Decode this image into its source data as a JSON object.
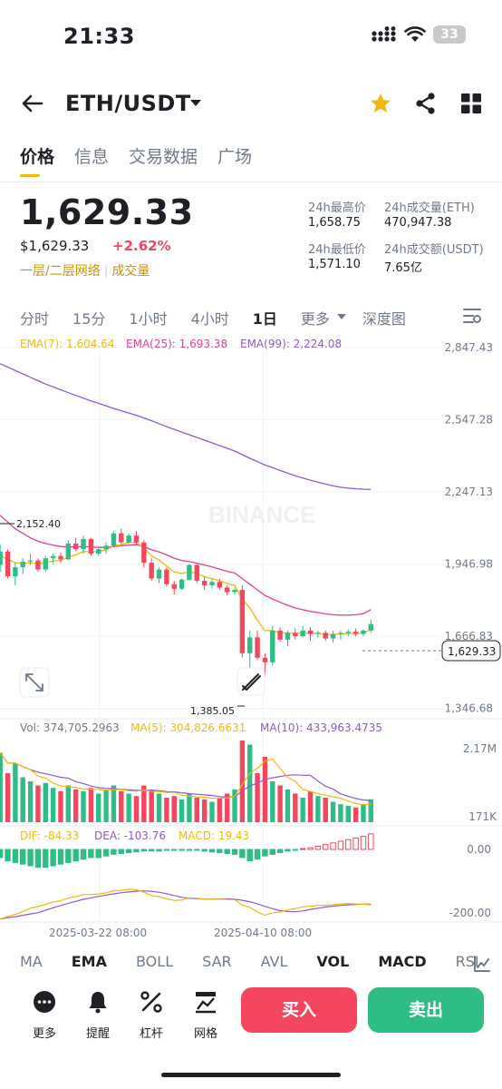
{
  "status": {
    "time": "21:33",
    "battery": "33"
  },
  "header": {
    "pair": "ETH/USDT"
  },
  "tabs": [
    {
      "label": "价格"
    },
    {
      "label": "信息"
    },
    {
      "label": "交易数据"
    },
    {
      "label": "广场"
    }
  ],
  "price": {
    "last": "1,629.33",
    "usd": "$1,629.33",
    "change": "+2.62%",
    "tag1": "一层/二层网络",
    "tag2": "成交量"
  },
  "stats": {
    "high_label": "24h最高价",
    "high": "1,658.75",
    "vol_eth_label": "24h成交量(ETH)",
    "vol_eth": "470,947.38",
    "low_label": "24h最低价",
    "low": "1,571.10",
    "vol_usdt_label": "24h成交额(USDT)",
    "vol_usdt": "7.65亿"
  },
  "intervals": [
    "分时",
    "15分",
    "1小时",
    "4小时",
    "1日",
    "更多",
    "深度图"
  ],
  "chart_labels": {
    "ema7": "EMA(7): 1,604.64",
    "ema25": "EMA(25): 1,693.38",
    "ema99": "EMA(99): 2,224.08",
    "watermark": "BINANCE",
    "high_mark": "2,152.40",
    "low_mark": "1,385.05",
    "current": "1,629.33",
    "vol": "Vol: 374,705.2963",
    "ma5": "MA(5): 304,826.6631",
    "ma10": "MA(10): 433,963.4735",
    "dif": "DIF: -84.33",
    "dea": "DEA: -103.76",
    "macd": "MACD: 19.43",
    "date1": "2025-03-22 08:00",
    "date2": "2025-04-10 08:00"
  },
  "chart_data": {
    "type": "candlestick",
    "price_axis": [
      "2,847.43",
      "2,547.28",
      "2,247.13",
      "1,946.98",
      "1,666.83",
      "1,346.68"
    ],
    "price_range": [
      1346.68,
      2847.43
    ],
    "volume_axis": [
      "2.17M",
      "171K"
    ],
    "macd_axis": [
      "0.00",
      "-200.00"
    ],
    "x_labels": [
      "2025-03-22 08:00",
      "2025-04-10 08:00"
    ],
    "candles": [
      [
        1890,
        1980,
        1860,
        1950
      ],
      [
        1950,
        1960,
        1830,
        1840
      ],
      [
        1840,
        1900,
        1800,
        1880
      ],
      [
        1880,
        1920,
        1850,
        1905
      ],
      [
        1905,
        1940,
        1890,
        1910
      ],
      [
        1910,
        1920,
        1860,
        1870
      ],
      [
        1870,
        1930,
        1860,
        1920
      ],
      [
        1920,
        1940,
        1895,
        1930
      ],
      [
        1930,
        1945,
        1900,
        1915
      ],
      [
        1915,
        2000,
        1910,
        1985
      ],
      [
        1985,
        2010,
        1950,
        1960
      ],
      [
        1960,
        2020,
        1940,
        2005
      ],
      [
        2005,
        2010,
        1930,
        1940
      ],
      [
        1940,
        1965,
        1930,
        1960
      ],
      [
        1960,
        1990,
        1940,
        1975
      ],
      [
        1975,
        2040,
        1965,
        2030
      ],
      [
        2030,
        2050,
        1980,
        1990
      ],
      [
        1990,
        2030,
        1985,
        2020
      ],
      [
        2020,
        2040,
        1980,
        1990
      ],
      [
        1990,
        2000,
        1880,
        1900
      ],
      [
        1900,
        1920,
        1820,
        1830
      ],
      [
        1830,
        1880,
        1810,
        1870
      ],
      [
        1870,
        1880,
        1795,
        1805
      ],
      [
        1805,
        1820,
        1760,
        1785
      ],
      [
        1785,
        1830,
        1780,
        1825
      ],
      [
        1825,
        1895,
        1820,
        1890
      ],
      [
        1890,
        1900,
        1810,
        1820
      ],
      [
        1820,
        1840,
        1780,
        1800
      ],
      [
        1800,
        1830,
        1785,
        1815
      ],
      [
        1815,
        1830,
        1780,
        1790
      ],
      [
        1790,
        1800,
        1755,
        1770
      ],
      [
        1770,
        1790,
        1760,
        1780
      ],
      [
        1780,
        1800,
        1480,
        1500
      ],
      [
        1500,
        1600,
        1385,
        1570
      ],
      [
        1570,
        1600,
        1470,
        1480
      ],
      [
        1480,
        1500,
        1400,
        1460
      ],
      [
        1460,
        1620,
        1445,
        1600
      ],
      [
        1600,
        1615,
        1550,
        1560
      ],
      [
        1560,
        1600,
        1530,
        1590
      ],
      [
        1590,
        1610,
        1560,
        1575
      ],
      [
        1575,
        1620,
        1570,
        1600
      ],
      [
        1600,
        1615,
        1555,
        1585
      ],
      [
        1585,
        1600,
        1570,
        1590
      ],
      [
        1590,
        1600,
        1555,
        1565
      ],
      [
        1565,
        1600,
        1545,
        1585
      ],
      [
        1585,
        1600,
        1560,
        1590
      ],
      [
        1590,
        1605,
        1575,
        1595
      ],
      [
        1595,
        1610,
        1575,
        1585
      ],
      [
        1585,
        1605,
        1575,
        1600
      ],
      [
        1600,
        1650,
        1590,
        1629
      ]
    ],
    "ema7": [
      1930,
      1915,
      1900,
      1898,
      1900,
      1895,
      1900,
      1908,
      1910,
      1925,
      1935,
      1950,
      1948,
      1950,
      1957,
      1975,
      1980,
      1990,
      1990,
      1965,
      1930,
      1912,
      1885,
      1860,
      1852,
      1862,
      1852,
      1838,
      1830,
      1820,
      1808,
      1800,
      1740,
      1700,
      1645,
      1600,
      1600,
      1590,
      1590,
      1586,
      1590,
      1588,
      1588,
      1582,
      1583,
      1585,
      1588,
      1587,
      1590,
      1604
    ],
    "ema25": [
      2110,
      2080,
      2050,
      2030,
      2010,
      1995,
      1985,
      1978,
      1972,
      1970,
      1970,
      1972,
      1970,
      1968,
      1968,
      1972,
      1975,
      1978,
      1980,
      1972,
      1958,
      1948,
      1935,
      1920,
      1910,
      1905,
      1898,
      1890,
      1882,
      1872,
      1862,
      1855,
      1830,
      1805,
      1780,
      1755,
      1740,
      1725,
      1712,
      1700,
      1692,
      1685,
      1680,
      1674,
      1670,
      1668,
      1668,
      1670,
      1675,
      1693
    ],
    "ema99": [
      2780,
      2765,
      2750,
      2735,
      2720,
      2705,
      2690,
      2678,
      2665,
      2652,
      2640,
      2628,
      2616,
      2605,
      2594,
      2582,
      2572,
      2562,
      2552,
      2540,
      2528,
      2515,
      2502,
      2490,
      2478,
      2466,
      2454,
      2442,
      2430,
      2418,
      2406,
      2394,
      2378,
      2362,
      2347,
      2332,
      2320,
      2308,
      2296,
      2285,
      2275,
      2265,
      2256,
      2248,
      2240,
      2234,
      2230,
      2227,
      2225,
      2224
    ],
    "volume": [
      0.85,
      0.6,
      0.72,
      0.55,
      0.5,
      0.45,
      0.48,
      0.42,
      0.38,
      0.45,
      0.4,
      0.38,
      0.42,
      0.35,
      0.4,
      0.45,
      0.38,
      0.35,
      0.32,
      0.45,
      0.4,
      0.35,
      0.3,
      0.32,
      0.28,
      0.35,
      0.3,
      0.28,
      0.25,
      0.3,
      0.35,
      0.4,
      1.0,
      0.95,
      0.6,
      0.8,
      0.5,
      0.45,
      0.4,
      0.35,
      0.3,
      0.38,
      0.32,
      0.3,
      0.25,
      0.22,
      0.2,
      0.18,
      0.22,
      0.28
    ],
    "macd": [
      -10,
      -14,
      -16,
      -18,
      -20,
      -22,
      -22,
      -20,
      -18,
      -16,
      -14,
      -12,
      -10,
      -10,
      -8,
      -6,
      -5,
      -4,
      -3,
      -2,
      -2,
      -2,
      -1,
      -1,
      -1,
      -1,
      -1,
      -2,
      -3,
      -4,
      -5,
      -6,
      -10,
      -14,
      -12,
      -8,
      -6,
      -4,
      -2,
      -1,
      1,
      2,
      4,
      6,
      8,
      10,
      12,
      14,
      16,
      19
    ]
  }
}
